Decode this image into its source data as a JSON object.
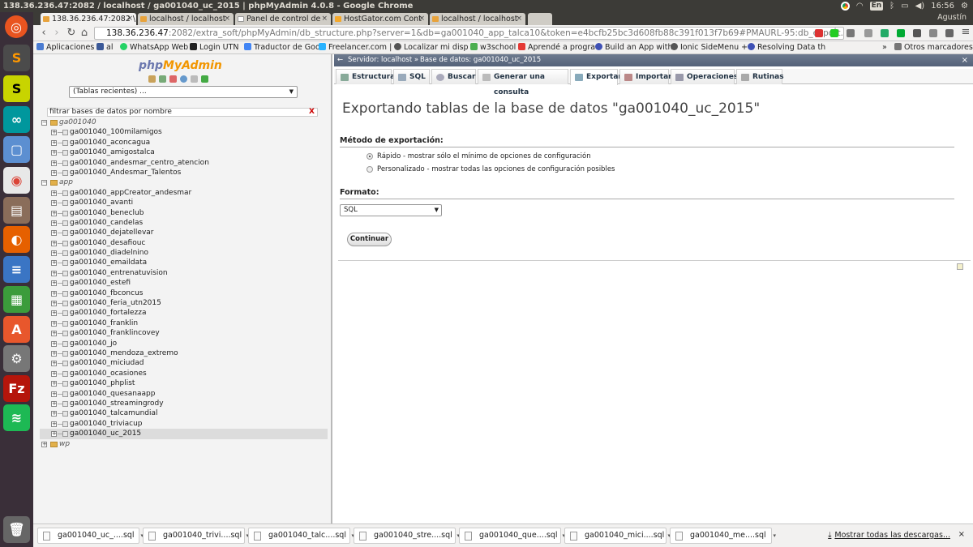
{
  "topbar": {
    "title": "138.36.236.47:2082 / localhost / ga001040_uc_2015 | phpMyAdmin 4.0.8 - Google Chrome",
    "keyboard": "En",
    "time": "16:56"
  },
  "browser": {
    "user": "Agustín",
    "tabs": [
      {
        "label": "138.36.236.47:2082 \\"
      },
      {
        "label": "localhost / localhost"
      },
      {
        "label": "Panel de control de"
      },
      {
        "label": "HostGator.com Cont"
      },
      {
        "label": "localhost / localhost"
      }
    ],
    "url_host": "138.36.236.47",
    "url_rest": ":2082/extra_soft/phpMyAdmin/db_structure.php?server=1&db=ga001040_app_talca10&token=e4bcfb25bc3d608fb88c391f013f7b69#PMAURL-95:db_export.php?db=ga001040",
    "bookmarks": [
      "Aplicaciones",
      "al",
      "WhatsApp Web",
      "Login UTN",
      "Traductor de Goo",
      "Freelancer.com |",
      "Localizar mi disp",
      "w3school",
      "Aprendé a progra",
      "Build an App with",
      "Ionic SideMenu +",
      "Resolving Data th"
    ],
    "bookmarks_more": "»",
    "other_bookmarks": "Otros marcadores"
  },
  "nav": {
    "logo_php": "php",
    "logo_myadmin": "MyAdmin",
    "recent": "(Tablas recientes) ...",
    "filter_placeholder": "filtrar bases de datos por nombre",
    "filter_clear": "X",
    "groups": [
      {
        "name": "ga001040",
        "dbs": [
          "ga001040_100milamigos",
          "ga001040_aconcagua",
          "ga001040_amigostalca",
          "ga001040_andesmar_centro_atencion",
          "ga001040_Andesmar_Talentos"
        ]
      },
      {
        "name": "app",
        "dbs": [
          "ga001040_appCreator_andesmar",
          "ga001040_avanti",
          "ga001040_beneclub",
          "ga001040_candelas",
          "ga001040_dejatellevar",
          "ga001040_desafiouc",
          "ga001040_diadelnino",
          "ga001040_emaildata",
          "ga001040_entrenatuvision",
          "ga001040_estefi",
          "ga001040_fbconcus",
          "ga001040_feria_utn2015",
          "ga001040_fortalezza",
          "ga001040_franklin",
          "ga001040_franklincovey",
          "ga001040_jo",
          "ga001040_mendoza_extremo",
          "ga001040_miciudad",
          "ga001040_ocasiones",
          "ga001040_phplist",
          "ga001040_quesanaapp",
          "ga001040_streamingrody",
          "ga001040_talcamundial",
          "ga001040_triviacup",
          "ga001040_uc_2015"
        ]
      },
      {
        "name": "wp",
        "dbs": []
      }
    ],
    "selected_db": "ga001040_uc_2015"
  },
  "main": {
    "breadcrumb_server": "Servidor: localhost »",
    "breadcrumb_db": "Base de datos: ga001040_uc_2015",
    "tabs": [
      "Estructura",
      "SQL",
      "Buscar",
      "Generar una consulta",
      "Exportar",
      "Importar",
      "Operaciones",
      "Rutinas"
    ],
    "active_tab": "Exportar",
    "heading": "Exportando tablas de la base de datos \"ga001040_uc_2015\"",
    "method_label": "Método de exportación:",
    "method_quick": "Rápido - mostrar sólo el mínimo de opciones de configuración",
    "method_custom": "Personalizado - mostrar todas las opciones de configuración posibles",
    "format_label": "Formato:",
    "format_value": "SQL",
    "continue_button": "Continuar"
  },
  "downloads": {
    "items": [
      "ga001040_uc_....sql",
      "ga001040_trivi....sql",
      "ga001040_talc....sql",
      "ga001040_stre....sql",
      "ga001040_que....sql",
      "ga001040_mici....sql",
      "ga001040_me....sql"
    ],
    "show_all": "Mostrar todas las descargas...",
    "close": "×"
  }
}
